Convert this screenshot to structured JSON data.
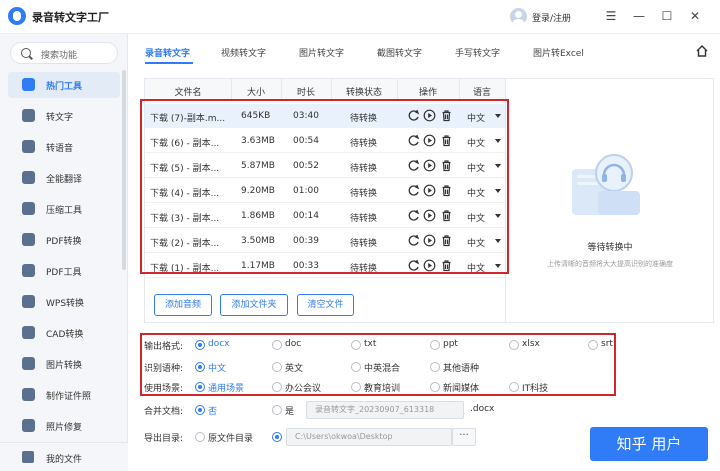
{
  "app": {
    "title": "录音转文字工厂",
    "login": "登录/注册"
  },
  "window": {
    "skin": "☰",
    "minimize": "—",
    "maximize": "☐",
    "close": "✕"
  },
  "sidebar": {
    "search_placeholder": "搜索功能",
    "items": [
      {
        "label": "热门工具",
        "icon": "fire-icon",
        "active": true
      },
      {
        "label": "转文字",
        "icon": "text-icon"
      },
      {
        "label": "转语音",
        "icon": "voice-icon"
      },
      {
        "label": "全能翻译",
        "icon": "translate-icon"
      },
      {
        "label": "压缩工具",
        "icon": "compress-icon"
      },
      {
        "label": "PDF转换",
        "icon": "pdf-convert-icon"
      },
      {
        "label": "PDF工具",
        "icon": "pdf-tool-icon"
      },
      {
        "label": "WPS转换",
        "icon": "wps-icon"
      },
      {
        "label": "CAD转换",
        "icon": "cad-icon"
      },
      {
        "label": "图片转换",
        "icon": "image-icon"
      },
      {
        "label": "制作证件照",
        "icon": "id-photo-icon"
      },
      {
        "label": "照片修复",
        "icon": "photo-repair-icon"
      }
    ],
    "footer": {
      "label": "我的文件",
      "icon": "folder-icon"
    }
  },
  "tabs": [
    {
      "label": "录音转文字",
      "active": true
    },
    {
      "label": "视频转文字"
    },
    {
      "label": "图片转文字"
    },
    {
      "label": "截图转文字"
    },
    {
      "label": "手写转文字"
    },
    {
      "label": "图片转Excel"
    }
  ],
  "table": {
    "headers": [
      "文件名",
      "大小",
      "时长",
      "转换状态",
      "操作",
      "语言"
    ],
    "rows": [
      {
        "name": "下载 (7)-副本.m...",
        "size": "645KB",
        "duration": "03:40",
        "status": "待转换",
        "lang": "中文"
      },
      {
        "name": "下载 (6) - 副本...",
        "size": "3.63MB",
        "duration": "00:54",
        "status": "待转换",
        "lang": "中文"
      },
      {
        "name": "下载 (5) - 副本...",
        "size": "5.87MB",
        "duration": "00:52",
        "status": "待转换",
        "lang": "中文"
      },
      {
        "name": "下载 (4) - 副本...",
        "size": "9.20MB",
        "duration": "01:00",
        "status": "待转换",
        "lang": "中文"
      },
      {
        "name": "下载 (3) - 副本...",
        "size": "1.86MB",
        "duration": "00:14",
        "status": "待转换",
        "lang": "中文"
      },
      {
        "name": "下载 (2) - 副本...",
        "size": "3.50MB",
        "duration": "00:39",
        "status": "待转换",
        "lang": "中文"
      },
      {
        "name": "下载 (1) - 副本...",
        "size": "1.17MB",
        "duration": "00:33",
        "status": "待转换",
        "lang": "中文"
      }
    ]
  },
  "buttons": {
    "add_audio": "添加音频",
    "add_folder": "添加文件夹",
    "clear": "清空文件"
  },
  "preview": {
    "title": "等待转换中",
    "subtitle": "上传清晰的音频将大大提高识别的准确度"
  },
  "options": {
    "format": {
      "label": "输出格式:",
      "choices": [
        "docx",
        "doc",
        "txt",
        "ppt",
        "xlsx",
        "srt"
      ],
      "selected": 0
    },
    "language": {
      "label": "识别语种:",
      "choices": [
        "中文",
        "英文",
        "中英混合",
        "其他语种"
      ],
      "selected": 0
    },
    "scene": {
      "label": "使用场景:",
      "choices": [
        "通用场景",
        "办公会议",
        "教育培训",
        "新闻媒体",
        "IT科技"
      ],
      "selected": 0
    },
    "merge": {
      "label": "合并文档:",
      "no": "否",
      "yes": "是",
      "filename": "录音转文字_20230907_613318",
      "ext": ".docx"
    },
    "output": {
      "label": "导出目录:",
      "source_dir": "原文件目录",
      "path": "C:\\Users\\okwoa\\Desktop",
      "browse": "···"
    }
  },
  "start_button": "知乎 用户",
  "colors": {
    "accent": "#2f7cf6",
    "highlight": "#d0262d"
  }
}
